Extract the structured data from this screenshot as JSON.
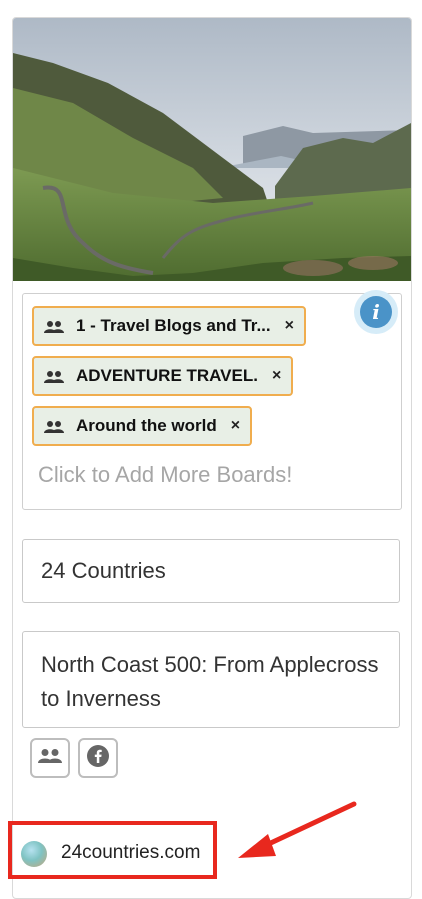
{
  "boards": {
    "tags": [
      {
        "label": "1 - Travel Blogs and Tr..."
      },
      {
        "label": "ADVENTURE TRAVEL."
      },
      {
        "label": "Around the world"
      }
    ],
    "remove_symbol": "×",
    "placeholder": "Click to Add More Boards!"
  },
  "fields": {
    "title": "24 Countries",
    "description": "North Coast 500: From Applecross to Inverness"
  },
  "source": {
    "site": "24countries.com"
  },
  "icons": {
    "info": "info-icon",
    "group": "group-icon",
    "facebook": "facebook-icon"
  },
  "colors": {
    "tag_border": "#f0ad4e",
    "tag_bg": "#e8efe6",
    "info": "#4a93c8",
    "annotation": "#e8281e"
  }
}
